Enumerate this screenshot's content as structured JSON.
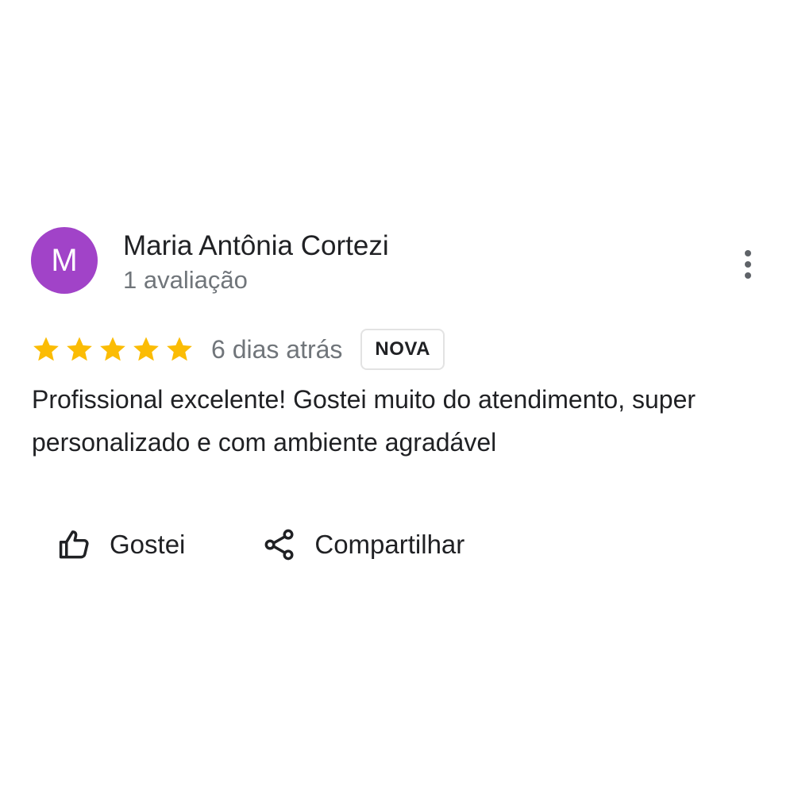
{
  "review": {
    "author": {
      "initial": "M",
      "name": "Maria Antônia Cortezi",
      "meta": "1 avaliação",
      "avatar_color": "#a143c8"
    },
    "menu_icon": "more-vert-icon",
    "rating": {
      "stars": 5,
      "max": 5,
      "star_color": "#fbbc04"
    },
    "date": "6 dias atrás",
    "badge": "NOVA",
    "text": "Profissional excelente! Gostei muito do atendimento, super personalizado e com ambiente agradável"
  },
  "actions": {
    "like": {
      "label": "Gostei",
      "icon": "thumb-up-icon"
    },
    "share": {
      "label": "Compartilhar",
      "icon": "share-icon"
    }
  }
}
